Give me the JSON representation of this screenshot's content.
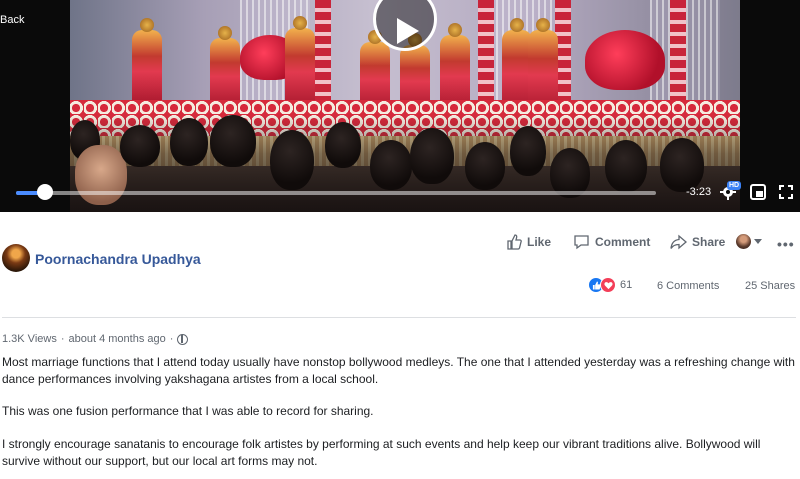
{
  "video": {
    "back_label": "Back",
    "time_remaining": "-3:23",
    "quality_badge": "HD",
    "progress_fraction": 0.045,
    "accent": "#4a8cff"
  },
  "post": {
    "author": "Poornachandra Upadhya",
    "actions": {
      "like": "Like",
      "comment": "Comment",
      "share": "Share"
    },
    "reactions": {
      "count": "61",
      "types": [
        "like",
        "love"
      ]
    },
    "comments_count": "6 Comments",
    "shares_count": "25 Shares",
    "views": "1.3K Views",
    "meta_separator": "·",
    "posted": "about 4 months ago",
    "body": [
      "Most marriage functions that I attend today usually have nonstop bollywood medleys. The one that I attended yesterday was a refreshing change with dance performances involving yakshagana artistes from a local school.",
      "This was one fusion performance that I was able to record for sharing.",
      "I strongly encourage sanatanis to encourage folk artistes by performing at such events and help keep our vibrant traditions alive. Bollywood will survive without our support, but our local art forms may not."
    ],
    "link_color": "#365899"
  },
  "icons": [
    "play-icon",
    "settings-gear-icon",
    "picture-in-picture-icon",
    "fullscreen-icon",
    "like-thumb-icon",
    "comment-bubble-icon",
    "share-arrow-icon",
    "globe-icon",
    "more-dots-icon"
  ]
}
